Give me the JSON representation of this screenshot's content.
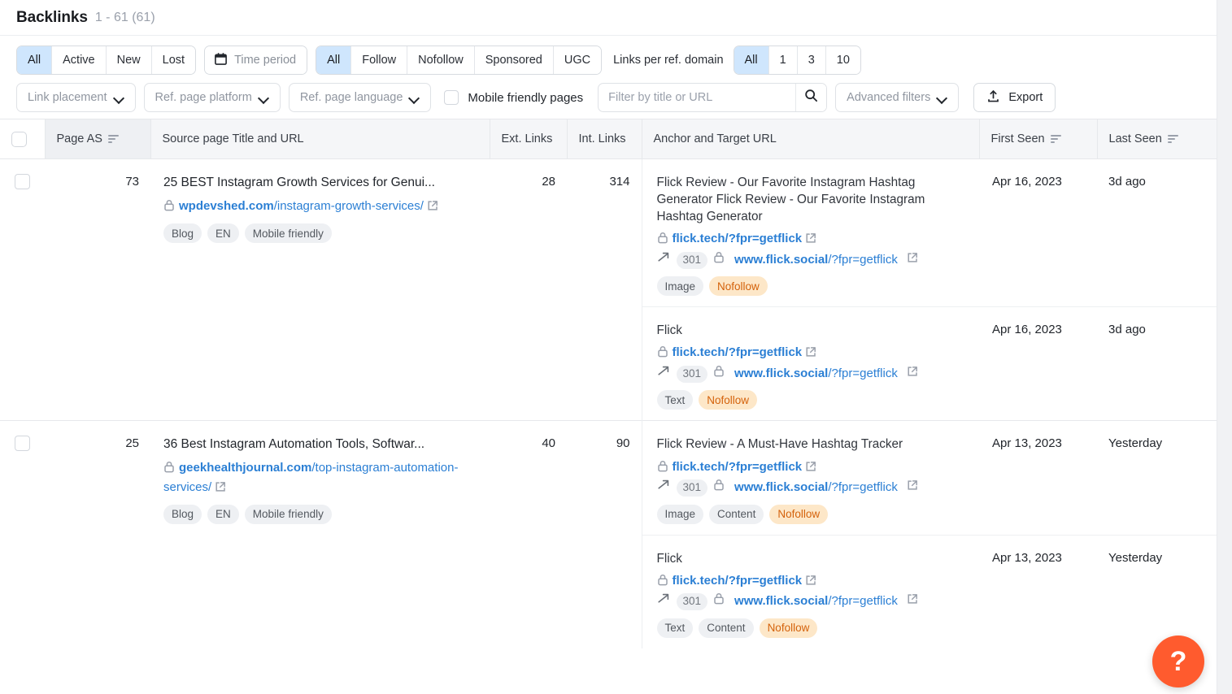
{
  "header": {
    "title": "Backlinks",
    "range": "1 - 61 (61)"
  },
  "filters": {
    "status_group": {
      "options": [
        "All",
        "Active",
        "New",
        "Lost"
      ],
      "selected": "All"
    },
    "time_period": {
      "label": "Time period",
      "icon": "calendar-icon"
    },
    "follow_group": {
      "options": [
        "All",
        "Follow",
        "Nofollow",
        "Sponsored",
        "UGC"
      ],
      "selected": "All"
    },
    "links_per_ref_domain": {
      "label": "Links per ref. domain",
      "options": [
        "All",
        "1",
        "3",
        "10"
      ],
      "selected": "All"
    },
    "link_placement": "Link placement",
    "ref_page_platform": "Ref. page platform",
    "ref_page_language": "Ref. page language",
    "mobile_friendly_pages": {
      "label": "Mobile friendly pages",
      "checked": false
    },
    "search": {
      "placeholder": "Filter by title or URL",
      "value": ""
    },
    "advanced_filters": "Advanced filters",
    "export": "Export"
  },
  "table": {
    "columns": [
      {
        "key": "check",
        "label": ""
      },
      {
        "key": "page_as",
        "label": "Page AS",
        "sortable": true
      },
      {
        "key": "source",
        "label": "Source page Title and URL",
        "sortable": false
      },
      {
        "key": "ext",
        "label": "Ext. Links",
        "sortable": false
      },
      {
        "key": "int",
        "label": "Int. Links",
        "sortable": false
      },
      {
        "key": "anchor",
        "label": "Anchor and Target URL",
        "sortable": false
      },
      {
        "key": "first_seen",
        "label": "First Seen",
        "sortable": true
      },
      {
        "key": "last_seen",
        "label": "Last Seen",
        "sortable": true
      }
    ],
    "rows": [
      {
        "page_as": "73",
        "source_title": "25 BEST Instagram Growth Services for Genui...",
        "source_domain": "wpdevshed.com",
        "source_path": "/instagram-growth-services/",
        "source_chips": [
          "Blog",
          "EN",
          "Mobile friendly"
        ],
        "ext_links": "28",
        "int_links": "314",
        "links": [
          {
            "anchor": "Flick Review - Our Favorite Instagram Hashtag Generator Flick Review - Our Favorite Instagram Hashtag Generator",
            "target_url": "flick.tech/?fpr=getflick",
            "redirect_code": "301",
            "redirect_domain": "www.flick.social",
            "redirect_path": "/?fpr=getflick",
            "chips": [
              "Image"
            ],
            "nofollow": "Nofollow",
            "first_seen": "Apr 16, 2023",
            "last_seen": "3d ago"
          },
          {
            "anchor": "Flick",
            "target_url": "flick.tech/?fpr=getflick",
            "redirect_code": "301",
            "redirect_domain": "www.flick.social",
            "redirect_path": "/?fpr=getflick",
            "chips": [
              "Text"
            ],
            "nofollow": "Nofollow",
            "first_seen": "Apr 16, 2023",
            "last_seen": "3d ago"
          }
        ]
      },
      {
        "page_as": "25",
        "source_title": "36 Best Instagram Automation Tools, Softwar...",
        "source_domain": "geekhealthjournal.com",
        "source_path": "/top-instagram-automation-services/",
        "source_chips": [
          "Blog",
          "EN",
          "Mobile friendly"
        ],
        "ext_links": "40",
        "int_links": "90",
        "links": [
          {
            "anchor": "Flick Review - A Must-Have Hashtag Tracker",
            "target_url": "flick.tech/?fpr=getflick",
            "redirect_code": "301",
            "redirect_domain": "www.flick.social",
            "redirect_path": "/?fpr=getflick",
            "chips": [
              "Image",
              "Content"
            ],
            "nofollow": "Nofollow",
            "first_seen": "Apr 13, 2023",
            "last_seen": "Yesterday"
          },
          {
            "anchor": "Flick",
            "target_url": "flick.tech/?fpr=getflick",
            "redirect_code": "301",
            "redirect_domain": "www.flick.social",
            "redirect_path": "/?fpr=getflick",
            "chips": [
              "Text",
              "Content"
            ],
            "nofollow": "Nofollow",
            "first_seen": "Apr 13, 2023",
            "last_seen": "Yesterday"
          }
        ]
      }
    ]
  },
  "help_button": {
    "label": "?",
    "color": "#ff5b2e"
  }
}
